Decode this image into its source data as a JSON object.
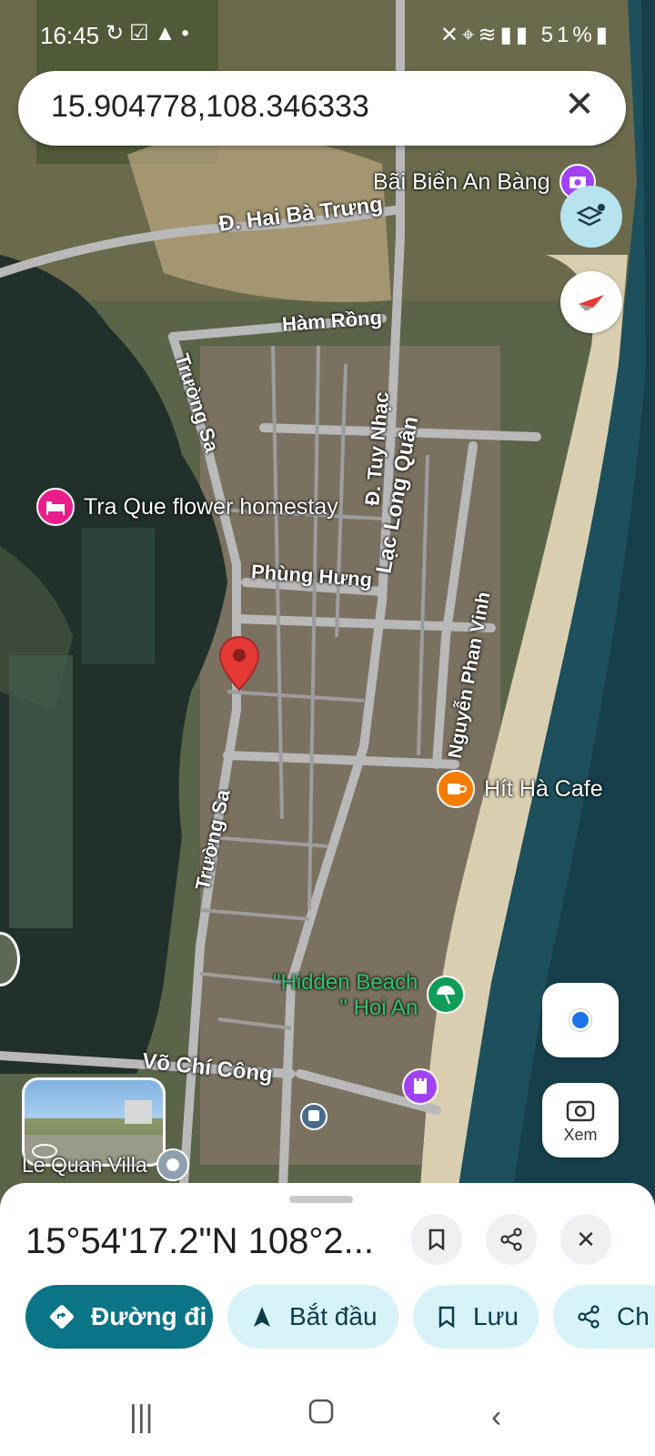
{
  "status_bar": {
    "time": "16:45",
    "battery": "51%"
  },
  "search": {
    "query": "15.904778,108.346333"
  },
  "map": {
    "labels": {
      "beach_an_bang": "Bãi Biển An Bàng",
      "hai_ba_trung": "Đ. Hai Bà Trưng",
      "ham_rong": "Hàm Rồng",
      "truong_sa_1": "Trường Sa",
      "truong_sa_2": "Trường Sa",
      "tuy_nhac": "Đ. Tuy Nhạc",
      "lac_long_quan": "Lạc Long Quân",
      "homestay": "Tra Que flower homestay",
      "phung_hung": "Phùng Hưng",
      "nguyen_phan_vinh": "Nguyễn Phan Vinh",
      "hit_ha_cafe": "Hít Hà Cafe",
      "hidden_beach_1": "\"Hidden Beach",
      "hidden_beach_2": "\" Hoi An",
      "vo_chi_cong": "Võ Chí Công",
      "le_quan_villa": "Le Quan Villa"
    }
  },
  "buttons": {
    "lens_label": "Xem"
  },
  "sheet": {
    "coordinates": "15°54'17.2\"N 108°2...",
    "directions": "Đường đi",
    "start": "Bắt đầu",
    "save": "Lưu",
    "share": "Ch"
  },
  "colors": {
    "accent": "#0b7487",
    "chip_bg": "#d7f3f8",
    "pin": "#e53935",
    "poi_pink": "#e91e8c",
    "poi_orange": "#f57c00",
    "poi_green": "#0f9d58",
    "poi_purple": "#a142f4"
  }
}
